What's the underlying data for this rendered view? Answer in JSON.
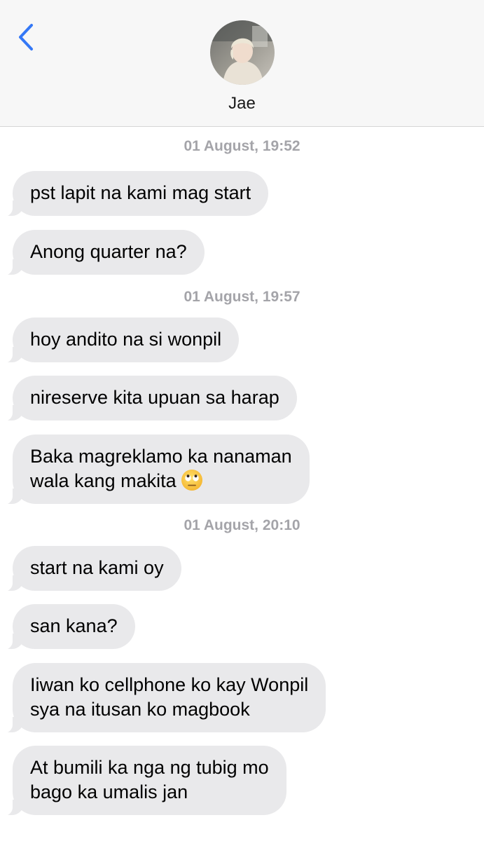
{
  "header": {
    "contact_name": "Jae",
    "back_icon": "chevron-left-icon",
    "accent_color": "#3478f6"
  },
  "messages_area": {
    "groups": [
      {
        "timestamp": "01 August, 19:52",
        "messages": [
          {
            "lines": [
              "pst lapit na kami mag start"
            ]
          },
          {
            "lines": [
              "Anong quarter na?"
            ]
          }
        ]
      },
      {
        "timestamp": "01 August, 19:57",
        "messages": [
          {
            "lines": [
              "hoy andito na si wonpil"
            ]
          },
          {
            "lines": [
              "nireserve kita upuan sa harap"
            ]
          },
          {
            "lines": [
              "Baka magreklamo ka nanaman",
              "wala kang makita"
            ],
            "emoji": "face-with-rolling-eyes-icon"
          }
        ]
      },
      {
        "timestamp": "01 August, 20:10",
        "messages": [
          {
            "lines": [
              "start na kami oy"
            ]
          },
          {
            "lines": [
              "san kana?"
            ]
          },
          {
            "lines": [
              "Iiwan ko cellphone ko kay Wonpil",
              "sya na itusan ko magbook"
            ]
          },
          {
            "lines": [
              "At bumili ka nga ng tubig mo",
              "bago ka umalis jan"
            ]
          }
        ]
      }
    ]
  },
  "colors": {
    "bubble_received": "#e9e9eb",
    "timestamp_text": "#a4a4a9",
    "header_bg": "#f7f7f7"
  }
}
